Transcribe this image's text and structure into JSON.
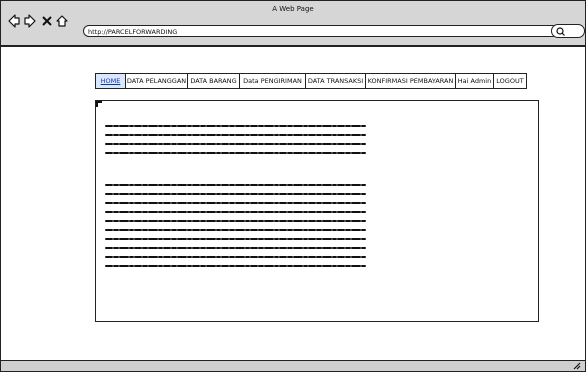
{
  "window": {
    "title": "A Web Page"
  },
  "address_bar": {
    "url": "http://PARCELFORWARDING"
  },
  "nav": {
    "items": [
      {
        "label": "HOME",
        "active": true
      },
      {
        "label": "DATA PELANGGAN"
      },
      {
        "label": "DATA BARANG"
      },
      {
        "label": "Data PENGIRIMAN"
      },
      {
        "label": "DATA TRANSAKSI"
      },
      {
        "label": "KONFIRMASI PEMBAYARAN"
      },
      {
        "label": "Hai Admin"
      },
      {
        "label": "LOGOUT"
      }
    ]
  },
  "content": {
    "paragraph1": "",
    "paragraph2": ""
  },
  "icons": {
    "back": "arrow-left-icon",
    "forward": "arrow-right-icon",
    "stop": "close-icon",
    "home": "home-icon",
    "search": "search-icon",
    "resize": "resize-grip-icon"
  },
  "colors": {
    "chrome": "#d6d6d6",
    "nav_active_bg": "#dbe6ff",
    "nav_active_text": "#0b3bb0"
  }
}
